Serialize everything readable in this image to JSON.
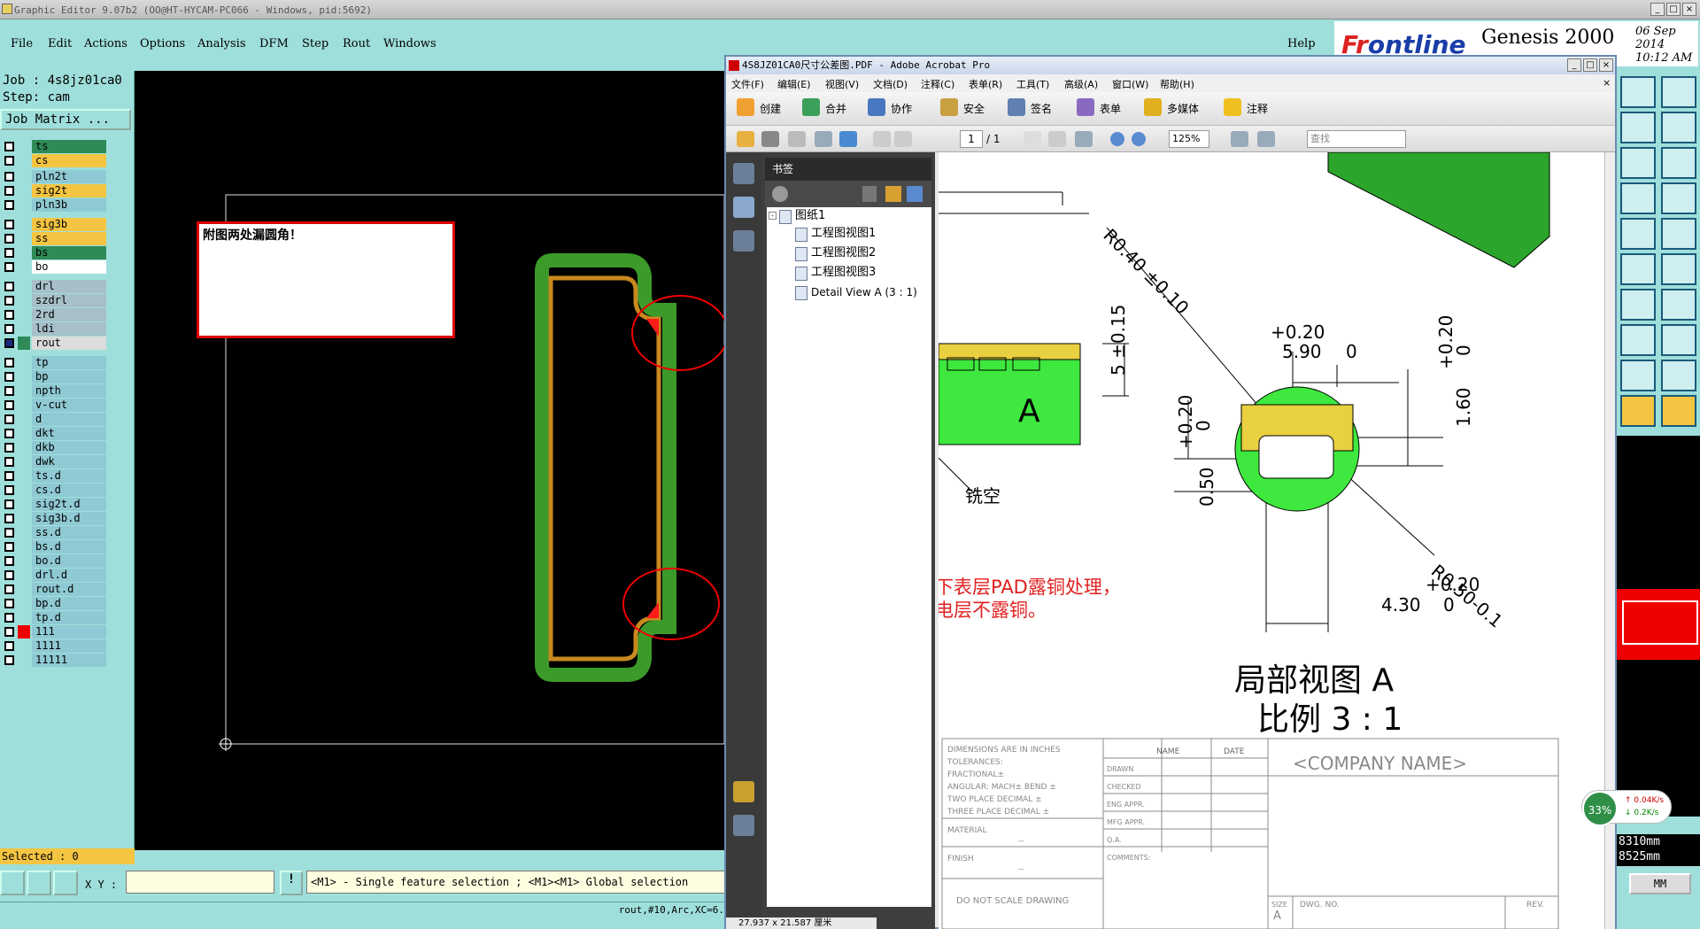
{
  "genesis": {
    "title": "Graphic Editor 9.07b2 (OO@HT-HYCAM-PC066 - Windows, pid:5692)",
    "menu": [
      "File",
      "Edit",
      "Actions",
      "Options",
      "Analysis",
      "DFM",
      "Step",
      "Rout",
      "Windows"
    ],
    "help": "Help",
    "brand": {
      "logo_a": "Fr",
      "logo_b": "ontline",
      "product": "Genesis 2000",
      "date": "06 Sep 2014",
      "time": "10:12 AM"
    },
    "job": "Job : 4s8jz01ca0",
    "step": "Step: cam",
    "job_matrix": "Job Matrix ...",
    "layers": [
      {
        "name": "ts",
        "color": "#2e8b57"
      },
      {
        "name": "cs",
        "color": "#f4c542"
      },
      {
        "name": "pln2t",
        "color": "#8fc9d3"
      },
      {
        "name": "sig2t",
        "color": "#f4c542"
      },
      {
        "name": "pln3b",
        "color": "#8fc9d3"
      },
      {
        "name": "sig3b",
        "color": "#f4c542"
      },
      {
        "name": "ss",
        "color": "#f4c542"
      },
      {
        "name": "bs",
        "color": "#2e8b57"
      },
      {
        "name": "bo",
        "color": "#ffffff"
      },
      {
        "name": "drl",
        "color": "#a7bfc8"
      },
      {
        "name": "szdrl",
        "color": "#a7bfc8"
      },
      {
        "name": "2rd",
        "color": "#a7bfc8"
      },
      {
        "name": "ldi",
        "color": "#a7bfc8"
      },
      {
        "name": "rout",
        "color": "#dcdcdc"
      },
      {
        "name": "tp",
        "color": "#8fc9d3"
      },
      {
        "name": "bp",
        "color": "#8fc9d3"
      },
      {
        "name": "npth",
        "color": "#8fc9d3"
      },
      {
        "name": "v-cut",
        "color": "#8fc9d3"
      },
      {
        "name": "d",
        "color": "#8fc9d3"
      },
      {
        "name": "dkt",
        "color": "#8fc9d3"
      },
      {
        "name": "dkb",
        "color": "#8fc9d3"
      },
      {
        "name": "dwk",
        "color": "#8fc9d3"
      },
      {
        "name": "ts.d",
        "color": "#8fc9d3"
      },
      {
        "name": "cs.d",
        "color": "#8fc9d3"
      },
      {
        "name": "sig2t.d",
        "color": "#8fc9d3"
      },
      {
        "name": "sig3b.d",
        "color": "#8fc9d3"
      },
      {
        "name": "ss.d",
        "color": "#8fc9d3"
      },
      {
        "name": "bs.d",
        "color": "#8fc9d3"
      },
      {
        "name": "bo.d",
        "color": "#8fc9d3"
      },
      {
        "name": "drl.d",
        "color": "#8fc9d3"
      },
      {
        "name": "rout.d",
        "color": "#8fc9d3"
      },
      {
        "name": "bp.d",
        "color": "#8fc9d3"
      },
      {
        "name": "tp.d",
        "color": "#8fc9d3"
      },
      {
        "name": "111",
        "color": "#8fc9d3"
      },
      {
        "name": "1111",
        "color": "#8fc9d3"
      },
      {
        "name": "11111",
        "color": "#8fc9d3"
      }
    ],
    "note": "附图两处漏圆角！",
    "selected": "Selected : 0",
    "xy_label": "X Y :",
    "hint": "<M1> - Single feature selection ; <M1><M1> Global selection",
    "feature": "rout,#10,Arc,XC=6.",
    "coords": [
      "8310mm",
      "8525mm"
    ],
    "units": "MM"
  },
  "acrobat": {
    "title": "4S8JZ01CA0尺寸公差图.PDF - Adobe Acrobat Pro",
    "menu": [
      "文件(F)",
      "编辑(E)",
      "视图(V)",
      "文档(D)",
      "注释(C)",
      "表单(R)",
      "工具(T)",
      "高级(A)",
      "窗口(W)",
      "帮助(H)"
    ],
    "toolbar": [
      "创建",
      "合并",
      "协作",
      "安全",
      "签名",
      "表单",
      "多媒体",
      "注释"
    ],
    "page_current": "1",
    "page_total": "/ 1",
    "zoom": "125%",
    "find_placeholder": "查找",
    "bookmarks_title": "书签",
    "bookmarks": [
      "图纸1",
      "工程图视图1",
      "工程图视图2",
      "工程图视图3",
      "Detail View A (3 : 1)"
    ],
    "page_size": "27.937 x 21.587 厘米",
    "drawing": {
      "dim_r040": "R0.40 ±0.10",
      "dim_590": "5.90",
      "dim_590_tol": "+0.20",
      "zero": "0",
      "dim_5": "5 ±0.15",
      "dim_160": "1.60",
      "dim_050": "0.50",
      "dim_430": "4.30",
      "dim_r050": "R0.50-0.1",
      "label_mill": "铣空",
      "note_red_1": "下表层PAD露铜处理，",
      "note_red_2": "电层不露铜。",
      "title_1": "局部视图 A",
      "title_2": "比例 3 : 1",
      "company": "<COMPANY NAME>",
      "tb_lines": [
        "DIMENSIONS ARE IN INCHES",
        "TOLERANCES:",
        "FRACTIONAL±",
        "ANGULAR: MACH±   BEND ±",
        "TWO PLACE DECIMAL   ±",
        "THREE PLACE DECIMAL  ±"
      ],
      "tb_name": "NAME",
      "tb_date": "DATE",
      "tb_rows": [
        "DRAWN",
        "CHECKED",
        "ENG APPR.",
        "MFG APPR.",
        "Q.A.",
        "COMMENTS:"
      ],
      "tb_material": "MATERIAL",
      "tb_finish": "FINISH",
      "tb_dash": "--",
      "tb_noscale": "DO NOT SCALE DRAWING",
      "tb_size": "SIZE",
      "tb_size_val": "A",
      "tb_dwgno": "DWG. NO.",
      "tb_rev": "REV."
    }
  },
  "speed": {
    "percent": "33%",
    "up": "0.04K/s",
    "down": "0.2K/s"
  }
}
